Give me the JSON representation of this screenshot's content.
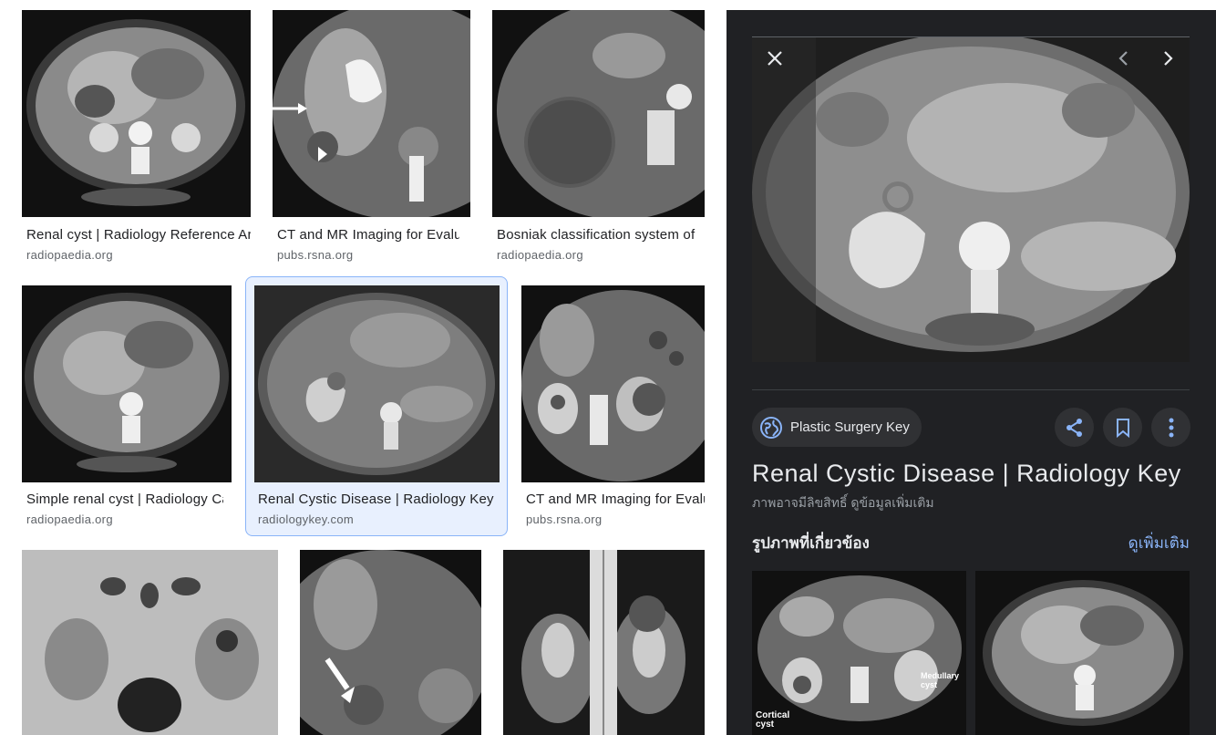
{
  "results": [
    {
      "title": "Renal cyst | Radiology Reference Article | Radiopaedia.org",
      "domain": "radiopaedia.org"
    },
    {
      "title": "CT and MR Imaging for Evaluation of Cystic Renal Lesions",
      "domain": "pubs.rsna.org"
    },
    {
      "title": "Bosniak classification system of renal cysts",
      "domain": "radiopaedia.org"
    },
    {
      "title": "Simple renal cyst | Radiology Case",
      "domain": "radiopaedia.org"
    },
    {
      "title": "Renal Cystic Disease | Radiology Key",
      "domain": "radiologykey.com"
    },
    {
      "title": "CT and MR Imaging for Evaluation of Cystic Renal Lesions",
      "domain": "pubs.rsna.org"
    }
  ],
  "panel": {
    "source": "Plastic Surgery Key",
    "title": "Renal Cystic Disease | Radiology Key",
    "copyright": "ภาพอาจมีลิขสิทธิ์ ดูข้อมูลเพิ่มเติม",
    "related_label": "รูปภาพที่เกี่ยวข้อง",
    "see_more": "ดูเพิ่มเติม",
    "related_captions": [
      "Cortical cyst",
      "Medullary cyst"
    ]
  },
  "icons": {
    "close": "close-icon",
    "prev": "chevron-left-icon",
    "next": "chevron-right-icon",
    "source": "globe-icon",
    "share": "share-icon",
    "save": "bookmark-icon",
    "more": "more-vert-icon"
  },
  "colors": {
    "panel_bg": "#202124",
    "link_blue": "#8ab4f8",
    "selected_bg": "#e8f0fe"
  }
}
